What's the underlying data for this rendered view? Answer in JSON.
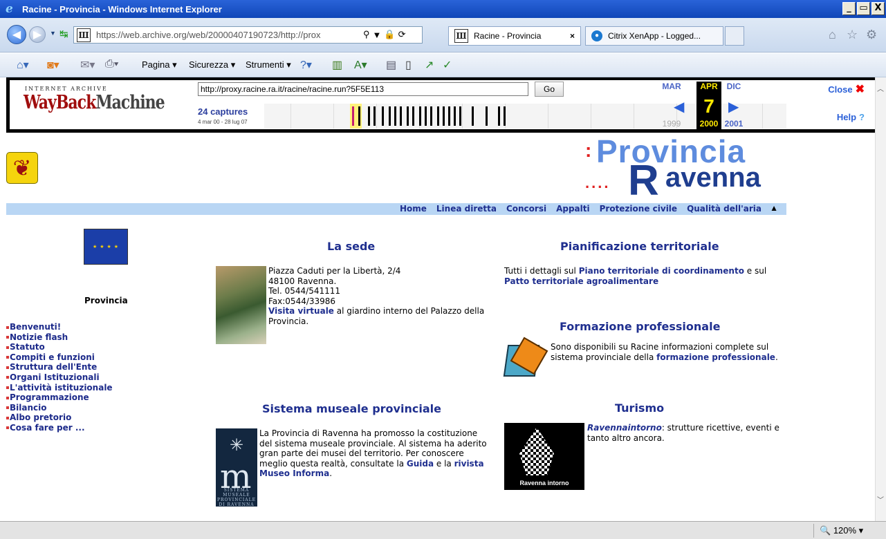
{
  "window": {
    "title": "Racine - Provincia - Windows Internet Explorer",
    "buttons": [
      "_",
      " ",
      "X"
    ]
  },
  "browser": {
    "address_url": "https://web.archive.org/web/20000407190723/http://prox",
    "tabs": [
      {
        "label": "Racine - Provincia",
        "close": "×"
      },
      {
        "label": "Citrix XenApp - Logged..."
      }
    ],
    "command_bar": [
      "Pagina",
      "Sicurezza",
      "Strumenti"
    ],
    "zoom": "120%"
  },
  "wayback": {
    "header": "INTERNET ARCHIVE",
    "logo_a": "WayBack",
    "logo_b": "Machine",
    "url": "http://proxy.racine.ra.it/racine/racine.run?5F5E113",
    "go": "Go",
    "captures": "24 captures",
    "range": "4 mar 00 - 28 lug 07",
    "months": {
      "prev": "MAR",
      "current": "APR",
      "next": "DIC"
    },
    "day": "7",
    "years": {
      "prev": "1999",
      "current": "2000",
      "next": "2001"
    },
    "close": "Close",
    "help": "Help"
  },
  "brand": {
    "provincia": "Provincia",
    "R": "R",
    "avenna": "avenna"
  },
  "topnav": [
    "Home",
    "Linea diretta",
    "Concorsi",
    "Appalti",
    "Protezione civile",
    "Qualità dell'aria"
  ],
  "sidebar": {
    "title": "Provincia",
    "items": [
      "Benvenuti!",
      "Notizie flash",
      "Statuto",
      "Compiti e funzioni",
      "Struttura dell'Ente",
      "Organi Istituzionali",
      "L'attività istituzionale",
      "Programmazione",
      "Bilancio",
      "Albo pretorio",
      "Cosa fare per ..."
    ]
  },
  "sections": {
    "sede": {
      "title": "La sede",
      "address": "Piazza Caduti per la Libertà, 2/4",
      "city": "48100 Ravenna.",
      "tel": "Tel. 0544/541111",
      "fax": "Fax:0544/33986",
      "link": "Visita virtuale",
      "rest": " al giardino interno del Palazzo della Provincia."
    },
    "pianificazione": {
      "title": "Pianificazione territoriale",
      "pre": "Tutti i dettagli sul ",
      "link1": "Piano territoriale di coordinamento",
      "mid": " e sul ",
      "link2": "Patto territoriale agroalimentare"
    },
    "formazione": {
      "title": "Formazione professionale",
      "text": "Sono disponibili su Racine informazioni complete sul sistema provinciale della ",
      "link": "formazione professionale",
      "end": "."
    },
    "musei": {
      "title": "Sistema museale provinciale",
      "text": "La Provincia di Ravenna ha promosso la costituzione del sistema museale provinciale. Al sistema ha aderito gran parte dei musei del territorio. Per conoscere meglio questa realtà, consultate la ",
      "link1": "Guida",
      "mid": " e la ",
      "link2": "rivista Museo Informa",
      "end": ".",
      "logo_caption": "SISTEMA MUSEALE PROVINCIALE DI RAVENNA"
    },
    "turismo": {
      "title": "Turismo",
      "link": "Ravennaintorno",
      "text": ": strutture ricettive, eventi e tanto altro ancora.",
      "logo_caption": "Ravenna intorno"
    }
  }
}
